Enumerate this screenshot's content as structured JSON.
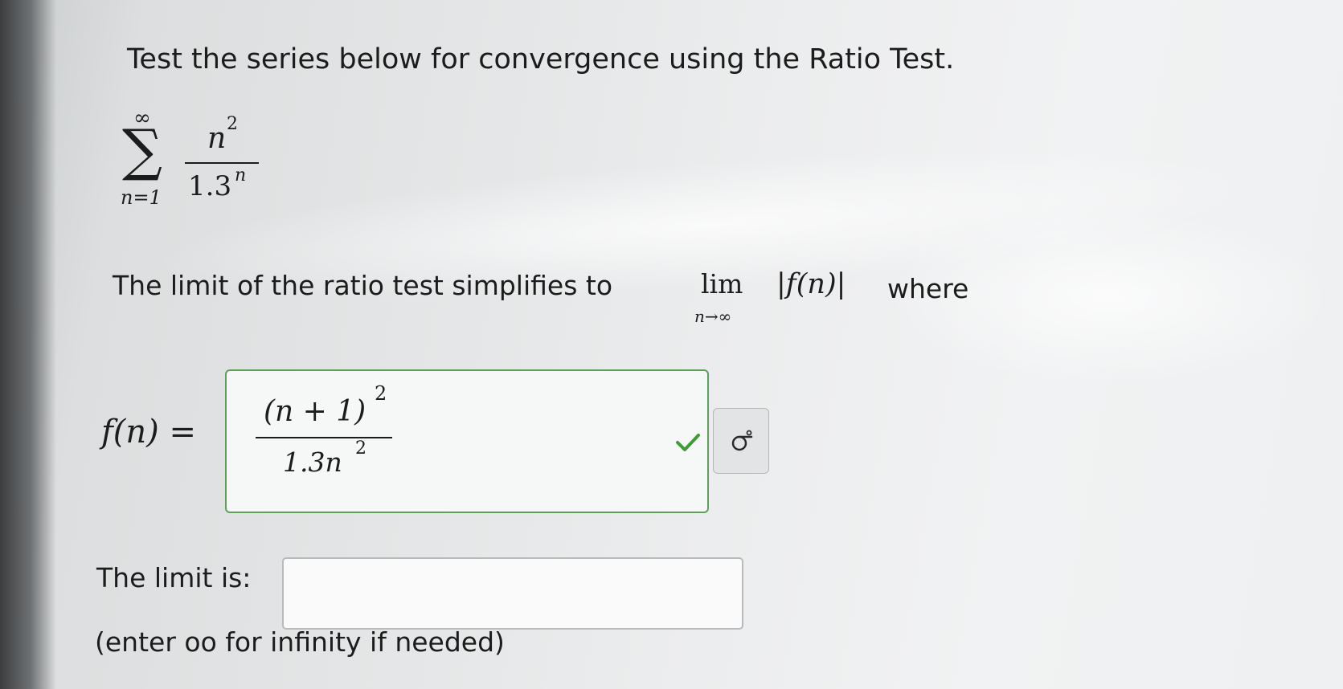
{
  "question": {
    "instruction": "Test the series below for convergence using the Ratio Test.",
    "series": {
      "upper_limit": "∞",
      "lower_limit": "n=1",
      "numerator": "n",
      "numerator_exp": "2",
      "denominator_base": "1.3",
      "denominator_exp": "n"
    },
    "limit_sentence": {
      "before": "The limit of the ratio test simplifies to",
      "lim": "lim",
      "lim_sub": "n→∞",
      "abs_expr": "|f(n)|",
      "after": "where"
    },
    "fn_answer": {
      "label": "f(n) =",
      "numerator": "(n + 1)",
      "numerator_exp": "2",
      "denominator": "1.3n",
      "denominator_exp": "2",
      "status": "correct",
      "status_color": "#3f9a3a",
      "preview_icon": "sigma-icon"
    },
    "limit_answer": {
      "label": "The limit is:",
      "value": "",
      "hint": "(enter oo for infinity if needed)"
    }
  }
}
